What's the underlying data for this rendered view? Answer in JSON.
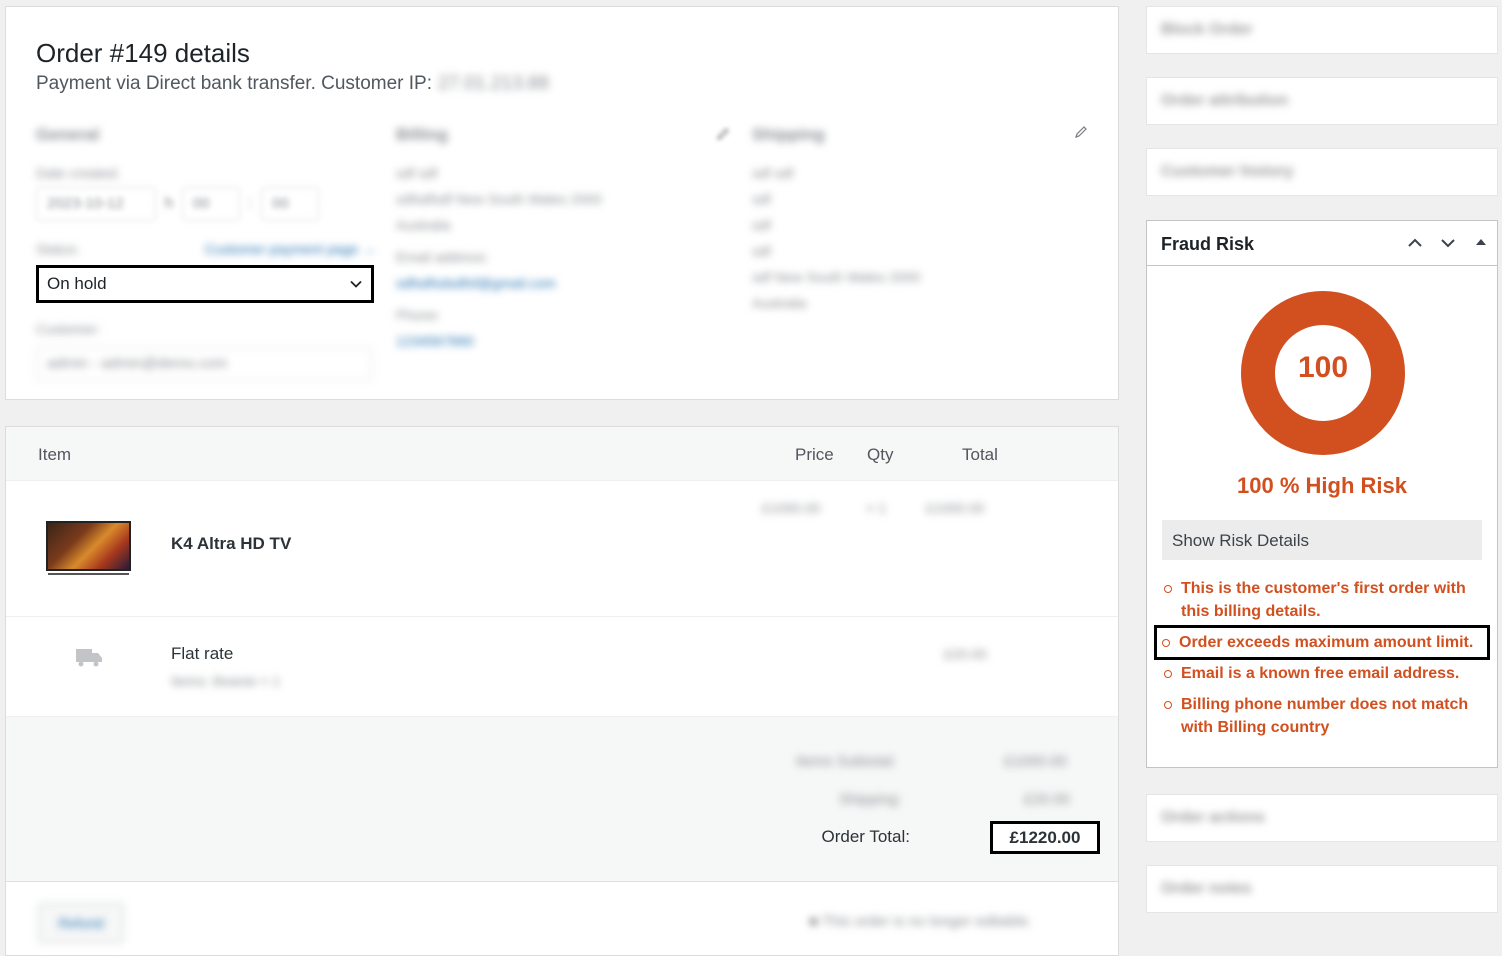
{
  "order": {
    "title": "Order #149 details",
    "subtitle": "Payment via Direct bank transfer. Customer IP:",
    "ip": "27.01.213.88"
  },
  "general": {
    "heading": "General",
    "date_label": "Date created:",
    "date": "2023-10-12",
    "hour": "h",
    "minute": "00",
    "second": "00",
    "status_label": "Status:",
    "status_link": "Customer payment page →",
    "status_value": "On hold",
    "customer_label": "Customer:",
    "customer_value": "admin - admin@demo.com"
  },
  "billing": {
    "heading": "Billing",
    "lines": [
      "sdf sdf",
      "sdfsdfsdf New South Wales 2000",
      "Australia"
    ],
    "email_label": "Email address:",
    "email": "sdfsdfsdsdfsf@gmail.com",
    "phone_label": "Phone:",
    "phone": "1234567890"
  },
  "shipping": {
    "heading": "Shipping",
    "lines": [
      "sdf sdf",
      "sdf",
      "sdf",
      "sdf",
      "sdf New South Wales 2000",
      "Australia"
    ]
  },
  "items": {
    "headers": {
      "item": "Item",
      "price": "Price",
      "qty": "Qty",
      "total": "Total"
    },
    "product": {
      "name": "K4 Altra HD TV",
      "price": "£1000.00",
      "qty": "× 1",
      "total": "£1000.00"
    },
    "shipping": {
      "name": "Flat rate",
      "meta": "Items: Beanie × 1",
      "total": "£20.00"
    },
    "totals": {
      "subtotal_label": "Items Subtotal:",
      "subtotal": "£1000.00",
      "shipping_label": "Shipping:",
      "shipping": "£20.00",
      "order_total_label": "Order Total:",
      "order_total": "£1220.00"
    },
    "refund_label": "Refund",
    "not_editable": "This order is no longer editable."
  },
  "sidebar": {
    "boxes": [
      "Block Order",
      "Order attribution",
      "Customer history",
      "Order actions",
      "Order notes"
    ]
  },
  "fraud": {
    "title": "Fraud Risk",
    "score": "100",
    "risk_label": "100 % High Risk",
    "details_button": "Show Risk Details",
    "reasons": [
      "This is the customer's first order with this billing details.",
      "Order exceeds maximum amount limit.",
      "Email is a known free email address.",
      "Billing phone number does not match with Billing country"
    ],
    "accent_color": "#d2501f"
  }
}
